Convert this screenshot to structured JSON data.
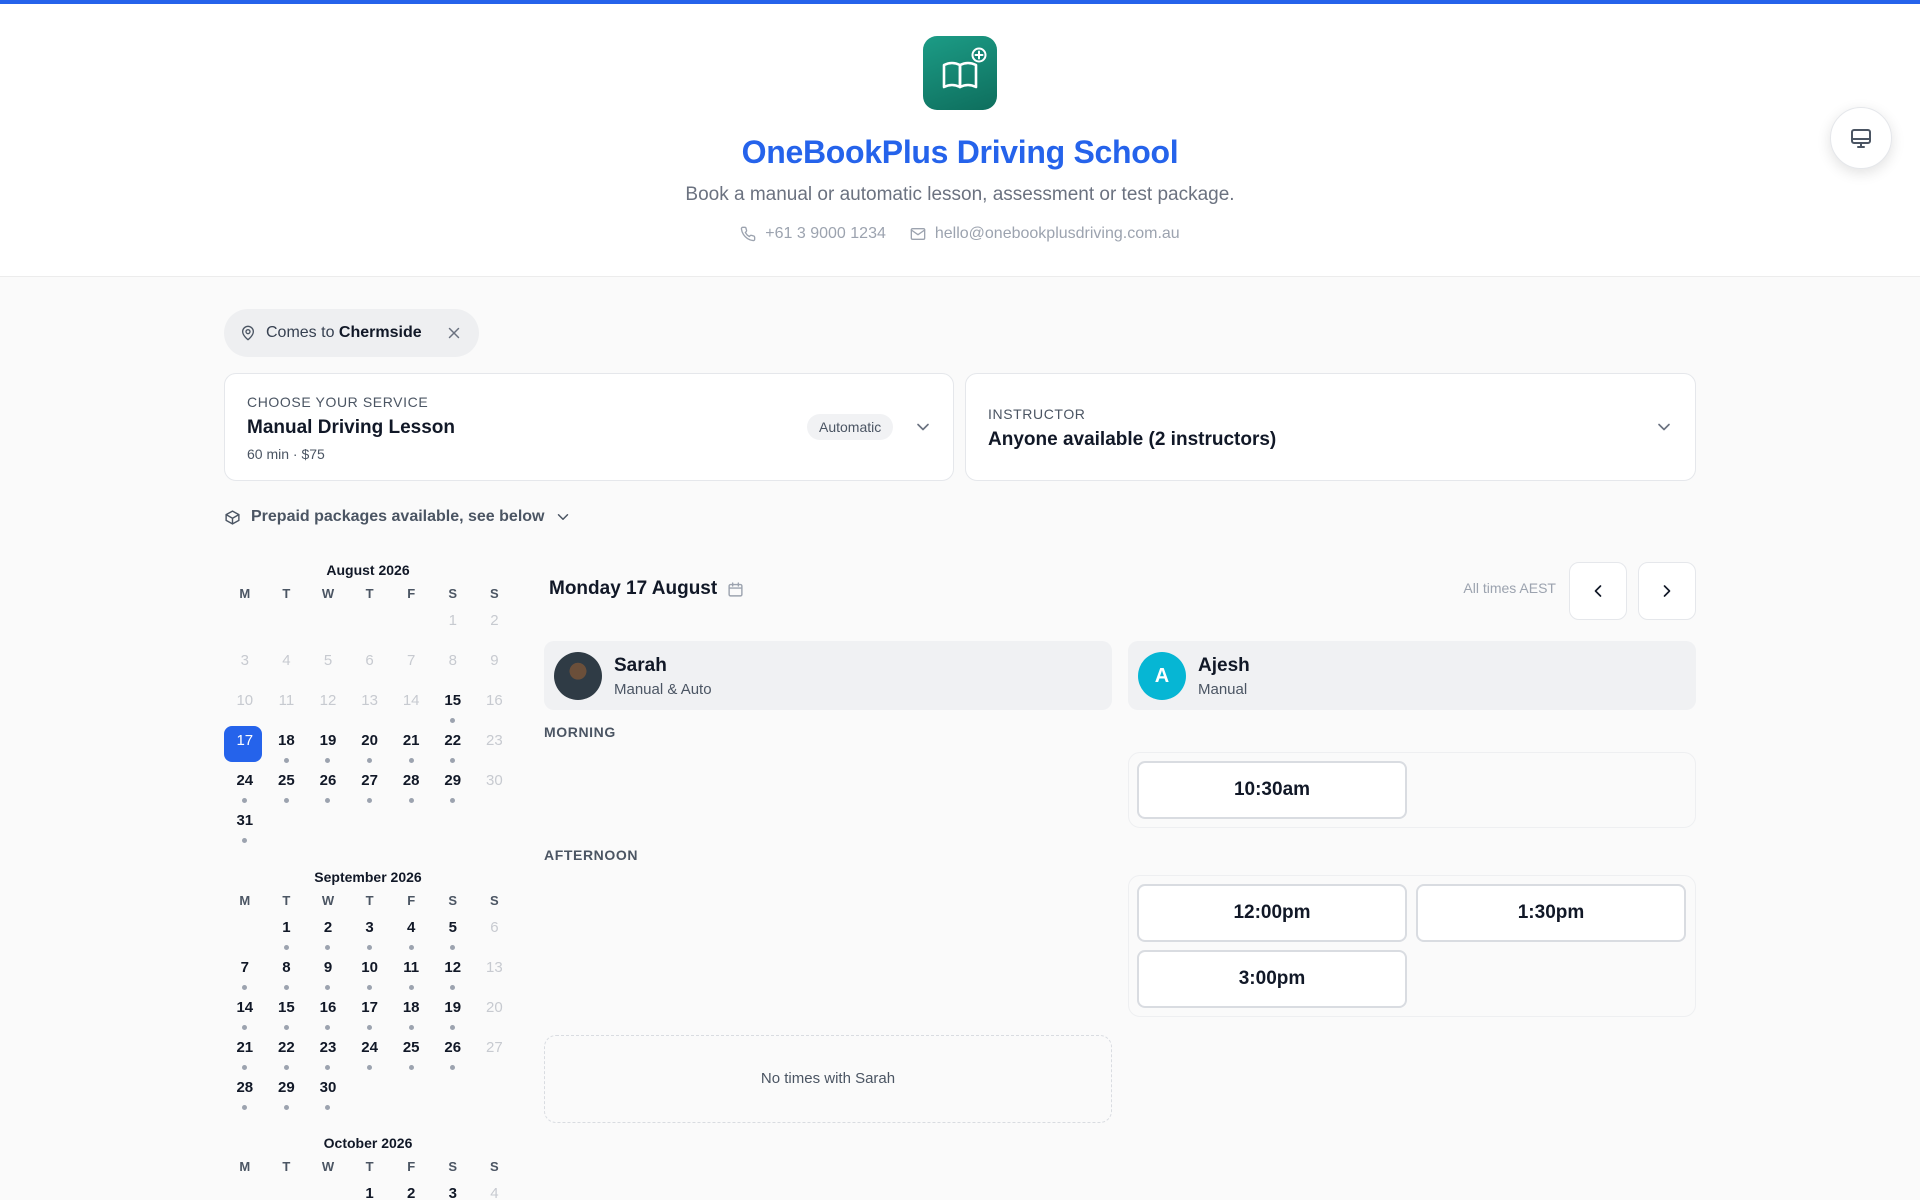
{
  "school": {
    "name": "OneBookPlus Driving School",
    "tagline": "Book a manual or automatic lesson, assessment or test package.",
    "phone": "+61 3 9000 1234",
    "email": "hello@onebookplusdriving.com.au"
  },
  "colors": {
    "accent": "#2563eb",
    "logo": "#138574",
    "avatar_ajesh": "#06b6d4"
  },
  "location": {
    "prefix": "Comes to",
    "suburb": "Chermside"
  },
  "service": {
    "eyebrow": "CHOOSE YOUR SERVICE",
    "name": "Manual Driving Lesson",
    "meta": "60 min · $75",
    "badge": "Automatic"
  },
  "instructor_select": {
    "eyebrow": "INSTRUCTOR",
    "value": "Anyone available (2 instructors)"
  },
  "packages_label": "Prepaid packages available, see below",
  "weekdays": [
    "M",
    "T",
    "W",
    "T",
    "F",
    "S",
    "S"
  ],
  "calendars": [
    {
      "title": "August 2026",
      "offset": 5,
      "days": [
        {
          "d": "1",
          "s": "dis"
        },
        {
          "d": "2",
          "s": "dis"
        },
        {
          "d": "3",
          "s": "dis"
        },
        {
          "d": "4",
          "s": "dis"
        },
        {
          "d": "5",
          "s": "dis"
        },
        {
          "d": "6",
          "s": "dis"
        },
        {
          "d": "7",
          "s": "dis"
        },
        {
          "d": "8",
          "s": "dis"
        },
        {
          "d": "9",
          "s": "dis"
        },
        {
          "d": "10",
          "s": "dis"
        },
        {
          "d": "11",
          "s": "dis"
        },
        {
          "d": "12",
          "s": "dis"
        },
        {
          "d": "13",
          "s": "dis"
        },
        {
          "d": "14",
          "s": "dis"
        },
        {
          "d": "15",
          "s": "av"
        },
        {
          "d": "16",
          "s": "dis"
        },
        {
          "d": "17",
          "s": "sel"
        },
        {
          "d": "18",
          "s": "av"
        },
        {
          "d": "19",
          "s": "av"
        },
        {
          "d": "20",
          "s": "av"
        },
        {
          "d": "21",
          "s": "av"
        },
        {
          "d": "22",
          "s": "av"
        },
        {
          "d": "23",
          "s": "dis"
        },
        {
          "d": "24",
          "s": "av"
        },
        {
          "d": "25",
          "s": "av"
        },
        {
          "d": "26",
          "s": "av"
        },
        {
          "d": "27",
          "s": "av"
        },
        {
          "d": "28",
          "s": "av"
        },
        {
          "d": "29",
          "s": "av"
        },
        {
          "d": "30",
          "s": "dis"
        },
        {
          "d": "31",
          "s": "av"
        }
      ]
    },
    {
      "title": "September 2026",
      "offset": 1,
      "days": [
        {
          "d": "1",
          "s": "av"
        },
        {
          "d": "2",
          "s": "av"
        },
        {
          "d": "3",
          "s": "av"
        },
        {
          "d": "4",
          "s": "av"
        },
        {
          "d": "5",
          "s": "av"
        },
        {
          "d": "6",
          "s": "dis"
        },
        {
          "d": "7",
          "s": "av"
        },
        {
          "d": "8",
          "s": "av"
        },
        {
          "d": "9",
          "s": "av"
        },
        {
          "d": "10",
          "s": "av"
        },
        {
          "d": "11",
          "s": "av"
        },
        {
          "d": "12",
          "s": "av"
        },
        {
          "d": "13",
          "s": "dis"
        },
        {
          "d": "14",
          "s": "av"
        },
        {
          "d": "15",
          "s": "av"
        },
        {
          "d": "16",
          "s": "av"
        },
        {
          "d": "17",
          "s": "av"
        },
        {
          "d": "18",
          "s": "av"
        },
        {
          "d": "19",
          "s": "av"
        },
        {
          "d": "20",
          "s": "dis"
        },
        {
          "d": "21",
          "s": "av"
        },
        {
          "d": "22",
          "s": "av"
        },
        {
          "d": "23",
          "s": "av"
        },
        {
          "d": "24",
          "s": "av"
        },
        {
          "d": "25",
          "s": "av"
        },
        {
          "d": "26",
          "s": "av"
        },
        {
          "d": "27",
          "s": "dis"
        },
        {
          "d": "28",
          "s": "av"
        },
        {
          "d": "29",
          "s": "av"
        },
        {
          "d": "30",
          "s": "av"
        }
      ]
    },
    {
      "title": "October 2026",
      "offset": 3,
      "days": [
        {
          "d": "1",
          "s": "av"
        },
        {
          "d": "2",
          "s": "av"
        },
        {
          "d": "3",
          "s": "av"
        },
        {
          "d": "4",
          "s": "dis"
        }
      ]
    }
  ],
  "day_view": {
    "heading": "Monday 17 August",
    "timezone": "All times AEST",
    "morning_label": "MORNING",
    "afternoon_label": "AFTERNOON",
    "instructors": [
      {
        "name": "Sarah",
        "role": "Manual & Auto",
        "empty_note": "No times with Sarah"
      },
      {
        "name": "Ajesh",
        "initial": "A",
        "role": "Manual",
        "morning_slots": [
          "10:30am"
        ],
        "afternoon_slots": [
          "12:00pm",
          "1:30pm",
          "3:00pm"
        ]
      }
    ]
  }
}
